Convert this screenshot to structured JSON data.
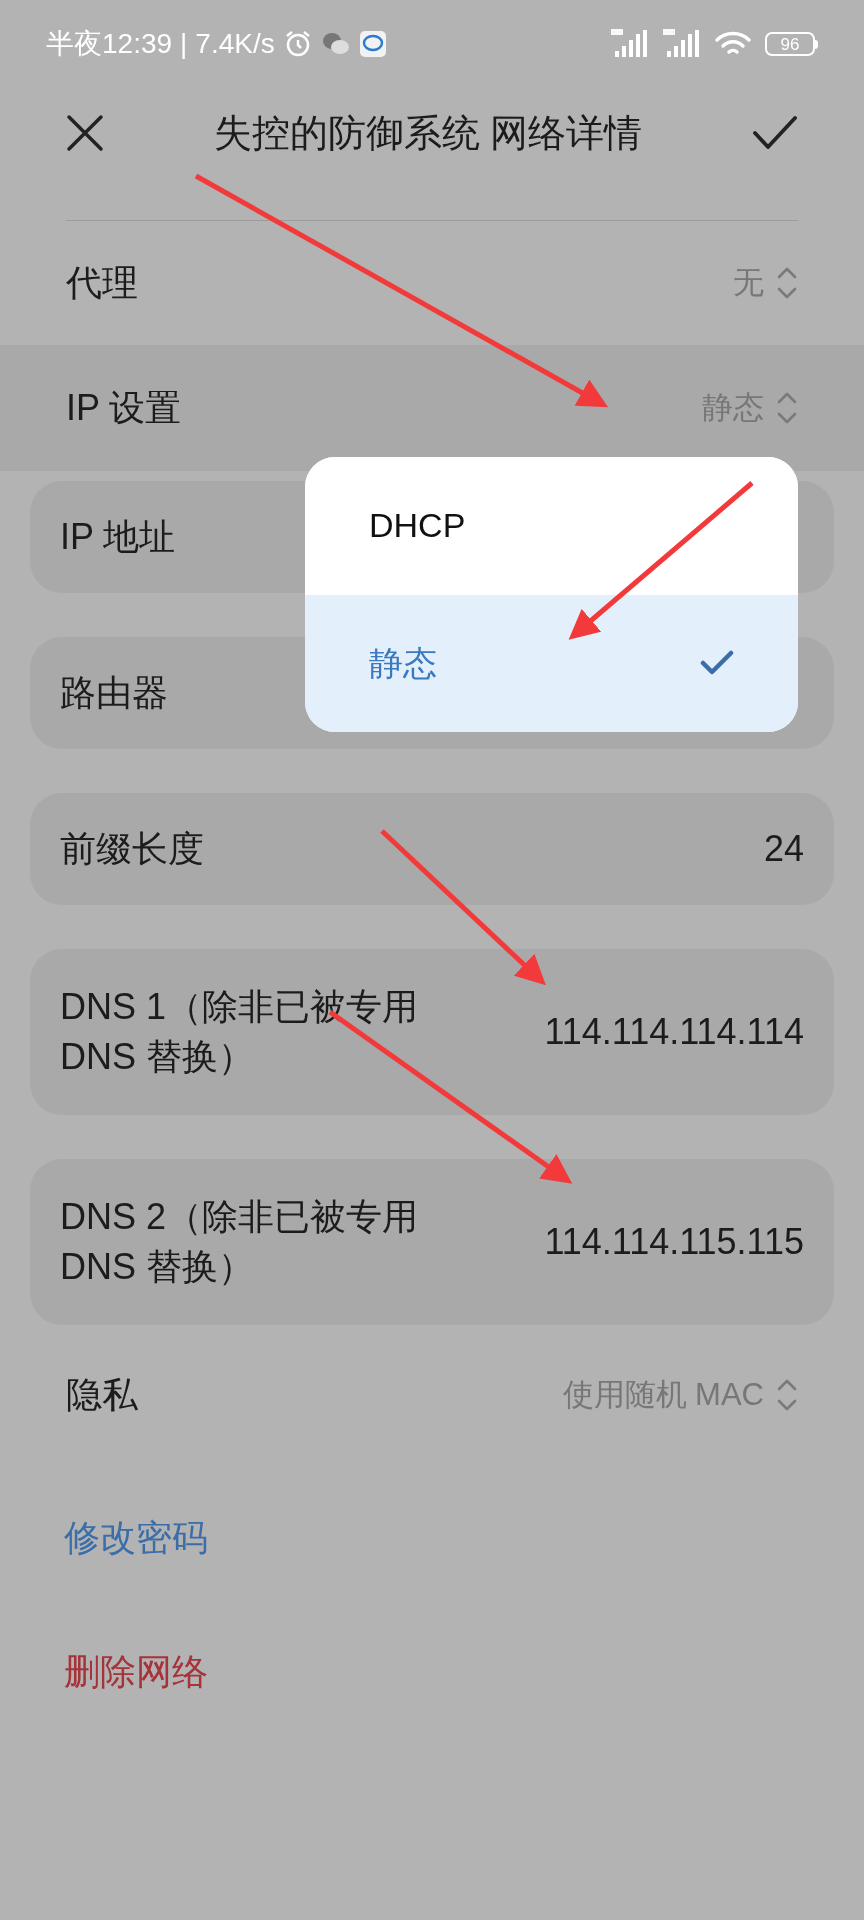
{
  "status_bar": {
    "time": "半夜12:39",
    "separator": "|",
    "speed": "7.4K/s",
    "battery": "96"
  },
  "header": {
    "title": "失控的防御系统 网络详情"
  },
  "settings": [
    {
      "label": "代理",
      "value": "无",
      "highlighted": false
    },
    {
      "label": "IP 设置",
      "value": "静态",
      "highlighted": true
    }
  ],
  "fields": [
    {
      "label": "IP 地址"
    },
    {
      "label": "路由器"
    },
    {
      "label": "前缀长度",
      "value": "24"
    },
    {
      "label": "DNS 1（除非已被专用 DNS 替换）",
      "value": "114.114.114.114"
    },
    {
      "label": "DNS 2（除非已被专用 DNS 替换）",
      "value": "114.114.115.115"
    }
  ],
  "privacy": {
    "label": "隐私",
    "value": "使用随机 MAC"
  },
  "actions": [
    {
      "kind": "normal",
      "label": "修改密码"
    },
    {
      "kind": "danger",
      "label": "删除网络"
    }
  ],
  "menu": [
    {
      "label": "DHCP",
      "selected": false
    },
    {
      "label": "静态",
      "selected": true
    }
  ]
}
